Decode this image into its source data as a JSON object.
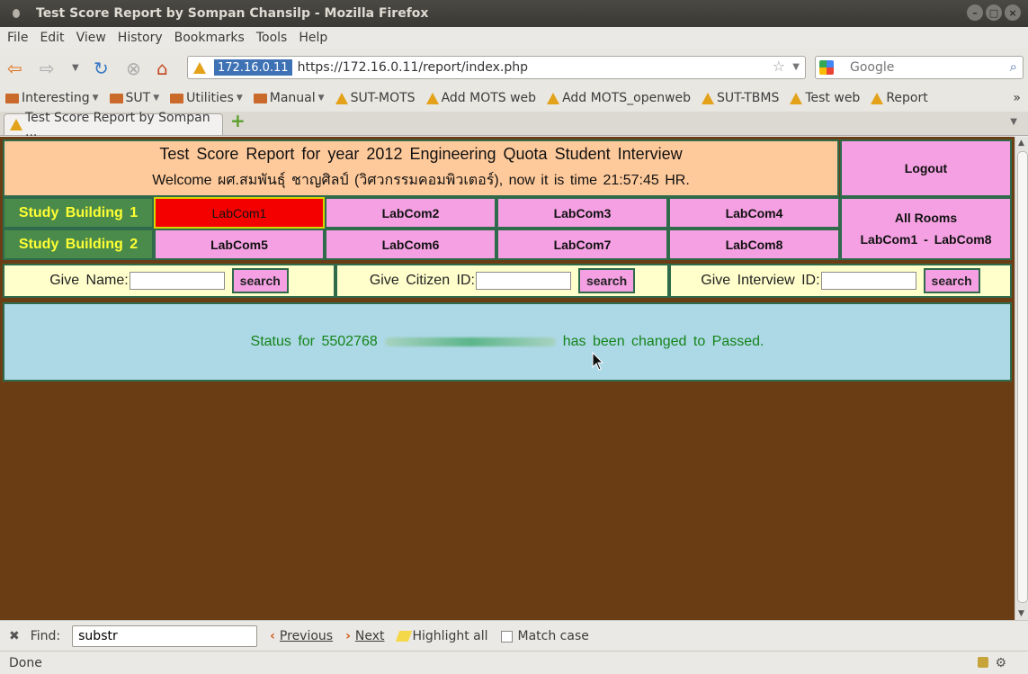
{
  "window": {
    "title": "Test Score Report by Sompan Chansilp - Mozilla Firefox"
  },
  "menu": [
    "File",
    "Edit",
    "View",
    "History",
    "Bookmarks",
    "Tools",
    "Help"
  ],
  "nav": {
    "ip": "172.16.0.11",
    "url": "https://172.16.0.11/report/index.php",
    "search_placeholder": "Google"
  },
  "bookmarks": [
    {
      "label": "Interesting",
      "type": "folder"
    },
    {
      "label": "SUT",
      "type": "folder"
    },
    {
      "label": "Utilities",
      "type": "folder"
    },
    {
      "label": "Manual",
      "type": "folder"
    },
    {
      "label": "SUT-MOTS",
      "type": "site"
    },
    {
      "label": "Add MOTS web",
      "type": "site"
    },
    {
      "label": "Add MOTS_openweb",
      "type": "site"
    },
    {
      "label": "SUT-TBMS",
      "type": "site"
    },
    {
      "label": "Test web",
      "type": "site"
    },
    {
      "label": "Report",
      "type": "site"
    }
  ],
  "tab": {
    "label": "Test Score Report by Sompan ..."
  },
  "page": {
    "title": "Test Score Report for year 2012 Engineering Quota Student Interview",
    "welcome": "Welcome ผศ.สมพันธุ์ ชาญศิลป์ (วิศวกรรมคอมพิวเตอร์), now it is time 21:57:45 HR.",
    "logout": "Logout",
    "building1": "Study Building 1",
    "building2": "Study Building 2",
    "labs1": [
      "LabCom1",
      "LabCom2",
      "LabCom3",
      "LabCom4"
    ],
    "labs2": [
      "LabCom5",
      "LabCom6",
      "LabCom7",
      "LabCom8"
    ],
    "all_rooms": "All Rooms",
    "all_rooms_range": "LabCom1 - LabCom8",
    "search": {
      "name_label": "Give Name:",
      "citizen_label": "Give Citizen ID:",
      "interview_label": "Give Interview ID:",
      "button": "search"
    },
    "status_prefix": "Status for 5502768",
    "status_suffix": "has been changed to Passed."
  },
  "findbar": {
    "label": "Find:",
    "value": "substr",
    "previous": "Previous",
    "next": "Next",
    "highlight": "Highlight all",
    "match_case": "Match case"
  },
  "statusbar": {
    "text": "Done"
  },
  "colors": {
    "header": "#ffca9b",
    "pink": "#f4a0e2",
    "green": "#4a8a4b",
    "yellow_text": "#ffff33",
    "active": "#f50000",
    "status_bg": "#add8e6",
    "page_bg": "#6b3d15"
  }
}
